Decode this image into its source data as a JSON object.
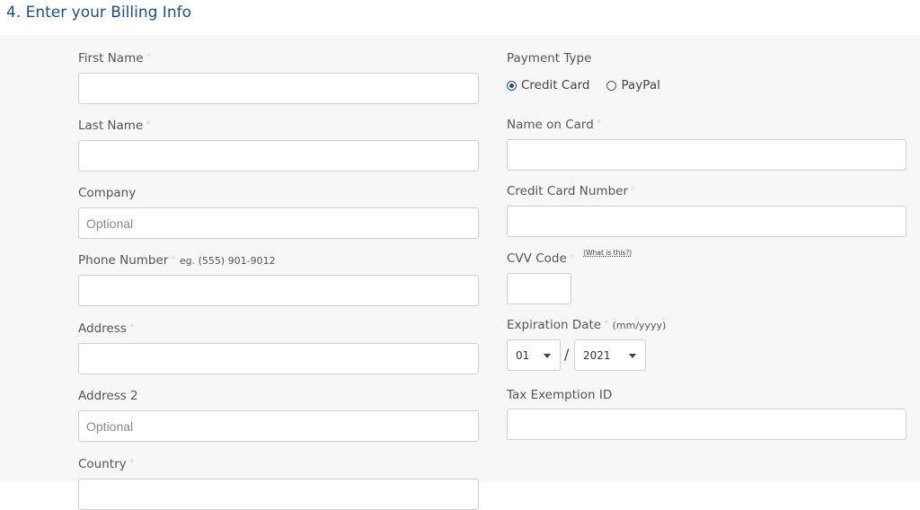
{
  "section": {
    "title": "4. Enter your Billing Info"
  },
  "left": {
    "first_name": {
      "label": "First Name",
      "value": "",
      "placeholder": ""
    },
    "last_name": {
      "label": "Last Name",
      "value": "",
      "placeholder": ""
    },
    "company": {
      "label": "Company",
      "value": "",
      "placeholder": "Optional"
    },
    "phone": {
      "label": "Phone Number",
      "hint": "eg. (555) 901-9012",
      "value": "",
      "placeholder": ""
    },
    "address": {
      "label": "Address",
      "value": "",
      "placeholder": ""
    },
    "address2": {
      "label": "Address 2",
      "value": "",
      "placeholder": "Optional"
    },
    "country": {
      "label": "Country"
    }
  },
  "right": {
    "payment_type": {
      "label": "Payment Type",
      "options": [
        {
          "label": "Credit Card",
          "selected": true
        },
        {
          "label": "PayPal",
          "selected": false
        }
      ]
    },
    "name_on_card": {
      "label": "Name on Card",
      "value": ""
    },
    "card_number": {
      "label": "Credit Card Number",
      "value": ""
    },
    "cvv": {
      "label": "CVV Code",
      "help_link": "(What is this?)",
      "value": ""
    },
    "expiration": {
      "label": "Expiration Date",
      "format_hint": "(mm/yyyy)",
      "month": "01",
      "separator": "/",
      "year": "2021"
    },
    "tax_id": {
      "label": "Tax Exemption ID",
      "value": ""
    }
  },
  "required_marker": "*",
  "colors": {
    "accent": "#1a4f8b",
    "panel_bg": "#f7f7f7",
    "border": "#cfcfcf"
  }
}
